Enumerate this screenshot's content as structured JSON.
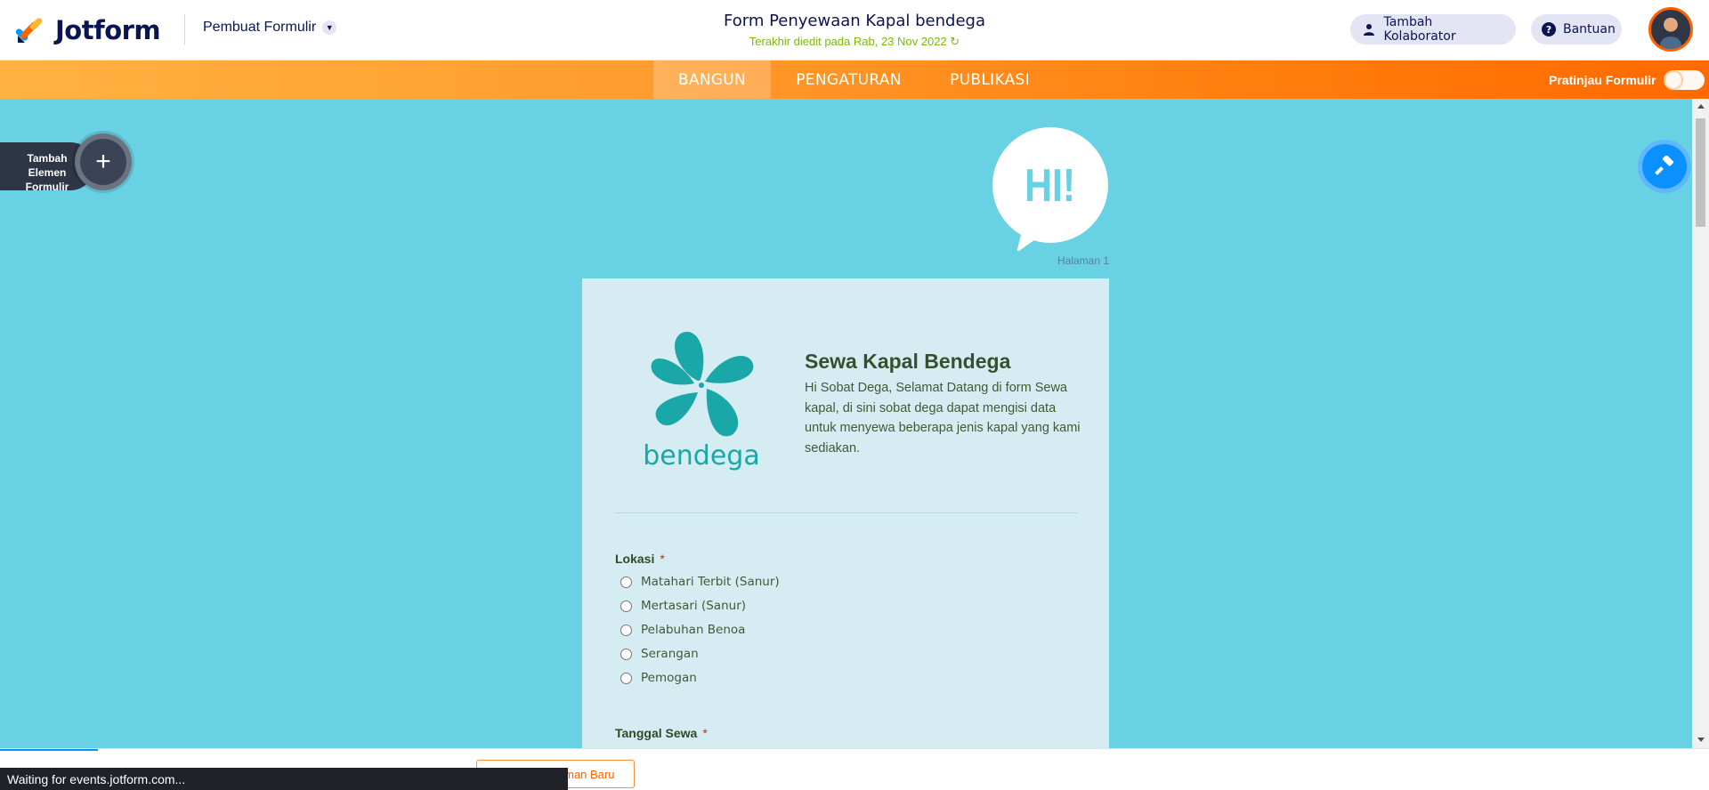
{
  "header": {
    "brand": "Jotform",
    "builder_menu": "Pembuat Formulir",
    "form_title": "Form Penyewaan Kapal bendega",
    "last_edited": "Terakhir diedit pada Rab, 23 Nov 2022",
    "collab_label": "Tambah Kolaborator",
    "help_label": "Bantuan"
  },
  "nav": {
    "tabs": [
      {
        "label": "BANGUN",
        "active": true
      },
      {
        "label": "PENGATURAN",
        "active": false
      },
      {
        "label": "PUBLIKASI",
        "active": false
      }
    ],
    "preview_label": "Pratinjau Formulir",
    "preview_on": false
  },
  "sidebar": {
    "add_label": "Tambah Elemen Formulir"
  },
  "canvas": {
    "bubble_text": "HI!",
    "page_label": "Halaman 1",
    "bg_color": "#69d1e4"
  },
  "form": {
    "brand_name": "bendega",
    "heading": "Sewa Kapal Bendega",
    "description": "Hi Sobat Dega, Selamat Datang di form Sewa kapal, di sini  sobat dega dapat mengisi data untuk menyewa beberapa jenis kapal yang kami sediakan.",
    "questions": [
      {
        "label": "Lokasi",
        "required_mark": "*",
        "options": [
          "Matahari Terbit (Sanur)",
          "Mertasari (Sanur)",
          "Pelabuhan Benoa",
          "Serangan",
          "Pemogan"
        ]
      },
      {
        "label": "Tanggal Sewa",
        "required_mark": "*"
      }
    ]
  },
  "footer": {
    "new_page_label": "Tambah Halaman Baru",
    "status_text": "Waiting for events.jotform.com..."
  },
  "colors": {
    "accent": "#ff6100",
    "navy": "#0a1551",
    "blue": "#0a91ff",
    "success": "#78bb07",
    "logo_teal": "#1aa7a7"
  }
}
